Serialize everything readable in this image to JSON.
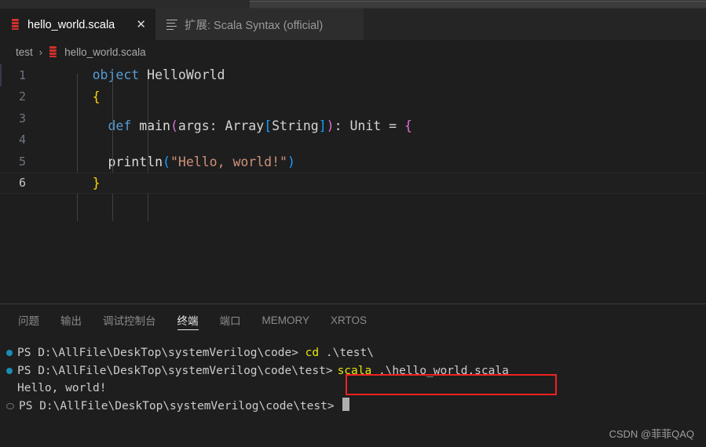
{
  "window": {
    "title_strip": ""
  },
  "tabs": [
    {
      "label": "hello_world.scala",
      "icon": "scala-file-icon",
      "active": true,
      "close_label": "✕"
    },
    {
      "label": "扩展: Scala Syntax (official)",
      "icon": "extension-list-icon",
      "active": false
    }
  ],
  "breadcrumb": {
    "root": "test",
    "separator": "›",
    "file": "hello_world.scala"
  },
  "editor": {
    "lines": [
      {
        "number": "1",
        "current": false
      },
      {
        "number": "2",
        "current": false
      },
      {
        "number": "3",
        "current": false
      },
      {
        "number": "4",
        "current": false
      },
      {
        "number": "5",
        "current": false
      },
      {
        "number": "6",
        "current": true
      }
    ],
    "code": {
      "l1_kw": "object",
      "l1_name": " HelloWorld",
      "l2_brace": "{",
      "l3_kw": "def",
      "l3_fn": " main",
      "l3_p_open": "(",
      "l3_args": "args: Array",
      "l3_b_open": "[",
      "l3_string": "String",
      "l3_b_close": "]",
      "l3_p_close": ")",
      "l3_ret": ": Unit = ",
      "l3_brace": "{",
      "l4_fn": "println",
      "l4_p_open": "(",
      "l4_str": "\"Hello, world!\"",
      "l4_p_close": ")",
      "l5_brace": "}",
      "l6_brace": "}"
    },
    "colors": {
      "keyword": "#569cd6",
      "string": "#ce9178",
      "bracket_yellow": "#ffd700",
      "bracket_pink": "#da70d6",
      "bracket_blue": "#179fff",
      "background": "#1e1e1e"
    }
  },
  "panel": {
    "tabs": [
      {
        "label": "问题",
        "active": false
      },
      {
        "label": "输出",
        "active": false
      },
      {
        "label": "调试控制台",
        "active": false
      },
      {
        "label": "终端",
        "active": true
      },
      {
        "label": "端口",
        "active": false
      },
      {
        "label": "MEMORY",
        "active": false
      },
      {
        "label": "XRTOS",
        "active": false
      }
    ],
    "terminal": {
      "lines": [
        {
          "marker": "ok",
          "prompt": "PS D:\\AllFile\\DeskTop\\systemVerilog\\code> ",
          "command": "cd",
          "args": " .\\test\\",
          "output": ""
        },
        {
          "marker": "ok",
          "prompt": "PS D:\\AllFile\\DeskTop\\systemVerilog\\code\\test>",
          "command": "scala",
          "args": " .\\hello_world.scala",
          "output": ""
        },
        {
          "marker": "none",
          "prompt": "",
          "command": "",
          "args": "",
          "output": "Hello, world!"
        },
        {
          "marker": "idle",
          "prompt": "PS D:\\AllFile\\DeskTop\\systemVerilog\\code\\test> ",
          "command": "",
          "args": "",
          "output": ""
        }
      ],
      "cursor_visible": true
    }
  },
  "annotation": {
    "highlight_color": "#f02222",
    "target": "scala .\\hello_world.scala"
  },
  "watermark": {
    "text": "CSDN @菲菲QAQ"
  }
}
